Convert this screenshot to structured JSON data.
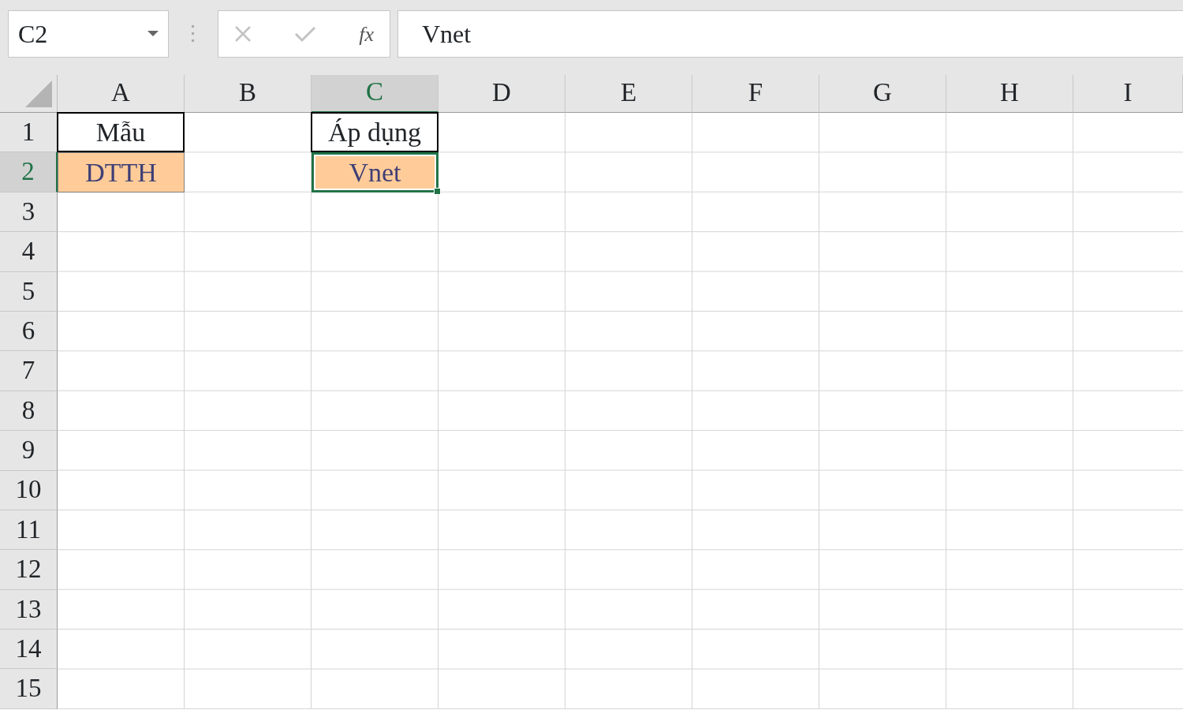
{
  "name_box": {
    "value": "C2"
  },
  "formula_bar": {
    "function_label": "fx",
    "value": "Vnet"
  },
  "columns": [
    {
      "label": "A",
      "selected": false
    },
    {
      "label": "B",
      "selected": false
    },
    {
      "label": "C",
      "selected": true
    },
    {
      "label": "D",
      "selected": false
    },
    {
      "label": "E",
      "selected": false
    },
    {
      "label": "F",
      "selected": false
    },
    {
      "label": "G",
      "selected": false
    },
    {
      "label": "H",
      "selected": false
    },
    {
      "label": "I",
      "selected": false
    }
  ],
  "rows": [
    {
      "label": "1",
      "selected": false,
      "cells": [
        {
          "text": "Mẫu",
          "kind": "bordered",
          "active": false
        },
        {},
        {
          "text": "Áp dụng",
          "kind": "bordered",
          "active": false
        }
      ]
    },
    {
      "label": "2",
      "selected": true,
      "cells": [
        {
          "text": "DTTH",
          "kind": "input",
          "active": false
        },
        {},
        {
          "text": "Vnet",
          "kind": "input",
          "active": true
        }
      ]
    },
    {
      "label": "3",
      "selected": false
    },
    {
      "label": "4",
      "selected": false
    },
    {
      "label": "5",
      "selected": false
    },
    {
      "label": "6",
      "selected": false
    },
    {
      "label": "7",
      "selected": false
    },
    {
      "label": "8",
      "selected": false
    },
    {
      "label": "9",
      "selected": false
    },
    {
      "label": "10",
      "selected": false
    },
    {
      "label": "11",
      "selected": false
    },
    {
      "label": "12",
      "selected": false
    },
    {
      "label": "13",
      "selected": false
    },
    {
      "label": "14",
      "selected": false
    },
    {
      "label": "15",
      "selected": false
    }
  ]
}
